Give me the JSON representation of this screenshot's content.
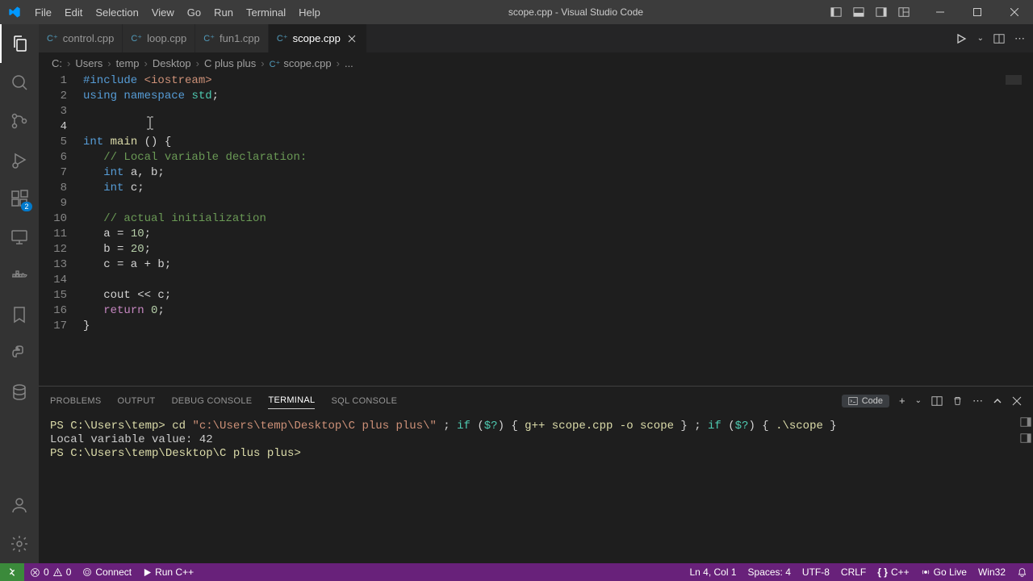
{
  "titlebar": {
    "menus": [
      "File",
      "Edit",
      "Selection",
      "View",
      "Go",
      "Run",
      "Terminal",
      "Help"
    ],
    "title": "scope.cpp - Visual Studio Code"
  },
  "tabs": [
    {
      "label": "control.cpp",
      "active": false
    },
    {
      "label": "loop.cpp",
      "active": false
    },
    {
      "label": "fun1.cpp",
      "active": false
    },
    {
      "label": "scope.cpp",
      "active": true
    }
  ],
  "breadcrumb": [
    "C:",
    "Users",
    "temp",
    "Desktop",
    "C plus plus",
    "scope.cpp",
    "..."
  ],
  "extensions_badge": "2",
  "code": {
    "lines": [
      {
        "n": 1,
        "segs": [
          [
            "#include ",
            "inc"
          ],
          [
            "<iostream>",
            "str"
          ]
        ]
      },
      {
        "n": 2,
        "segs": [
          [
            "using ",
            "kw"
          ],
          [
            "namespace ",
            "kw"
          ],
          [
            "std",
            "type"
          ],
          [
            ";",
            "txt"
          ]
        ]
      },
      {
        "n": 3,
        "segs": []
      },
      {
        "n": 4,
        "segs": [],
        "active": true
      },
      {
        "n": 5,
        "segs": [
          [
            "int ",
            "kw"
          ],
          [
            "main ",
            "fn"
          ],
          [
            "() {",
            "txt"
          ]
        ]
      },
      {
        "n": 6,
        "segs": [
          [
            "   ",
            "txt"
          ],
          [
            "// Local variable declaration:",
            "cmt"
          ]
        ]
      },
      {
        "n": 7,
        "segs": [
          [
            "   ",
            "txt"
          ],
          [
            "int ",
            "kw"
          ],
          [
            "a, b;",
            "txt"
          ]
        ]
      },
      {
        "n": 8,
        "segs": [
          [
            "   ",
            "txt"
          ],
          [
            "int ",
            "kw"
          ],
          [
            "c;",
            "txt"
          ]
        ]
      },
      {
        "n": 9,
        "segs": []
      },
      {
        "n": 10,
        "segs": [
          [
            "   ",
            "txt"
          ],
          [
            "// actual initialization",
            "cmt"
          ]
        ]
      },
      {
        "n": 11,
        "segs": [
          [
            "   a = ",
            "txt"
          ],
          [
            "10",
            "num"
          ],
          [
            ";",
            "txt"
          ]
        ]
      },
      {
        "n": 12,
        "segs": [
          [
            "   b = ",
            "txt"
          ],
          [
            "20",
            "num"
          ],
          [
            ";",
            "txt"
          ]
        ]
      },
      {
        "n": 13,
        "segs": [
          [
            "   c = a + b;",
            "txt"
          ]
        ]
      },
      {
        "n": 14,
        "segs": []
      },
      {
        "n": 15,
        "segs": [
          [
            "   cout << c;",
            "txt"
          ]
        ]
      },
      {
        "n": 16,
        "segs": [
          [
            "   ",
            "txt"
          ],
          [
            "return ",
            "pp"
          ],
          [
            "0",
            "num"
          ],
          [
            ";",
            "txt"
          ]
        ]
      },
      {
        "n": 17,
        "segs": [
          [
            "}",
            "txt"
          ]
        ]
      }
    ]
  },
  "panel": {
    "tabs": [
      "PROBLEMS",
      "OUTPUT",
      "DEBUG CONSOLE",
      "TERMINAL",
      "SQL CONSOLE"
    ],
    "active": "TERMINAL",
    "action_label": "Code",
    "terminal": {
      "l1_prompt": "PS C:\\Users\\temp> ",
      "l1_cmd": "cd ",
      "l1_path": "\"c:\\Users\\temp\\Desktop\\C plus plus\\\"",
      "l1_sep": " ; ",
      "l1_if1": "if",
      "l1_p1": " (",
      "l1_v1": "$?",
      "l1_p2": ") { ",
      "l1_g": "g++ scope.cpp -o scope",
      "l1_p3": " } ; ",
      "l1_if2": "if",
      "l1_p4": " (",
      "l1_v2": "$?",
      "l1_p5": ") { ",
      "l1_run": ".\\scope",
      "l1_p6": " }",
      "l2": "Local variable value: 42",
      "l3": "PS C:\\Users\\temp\\Desktop\\C plus plus> "
    }
  },
  "statusbar": {
    "errors": "0",
    "warnings": "0",
    "connect": "Connect",
    "run": "Run C++",
    "pos": "Ln 4, Col 1",
    "spaces": "Spaces: 4",
    "encoding": "UTF-8",
    "eol": "CRLF",
    "lang": "C++",
    "golive": "Go Live",
    "win": "Win32"
  }
}
